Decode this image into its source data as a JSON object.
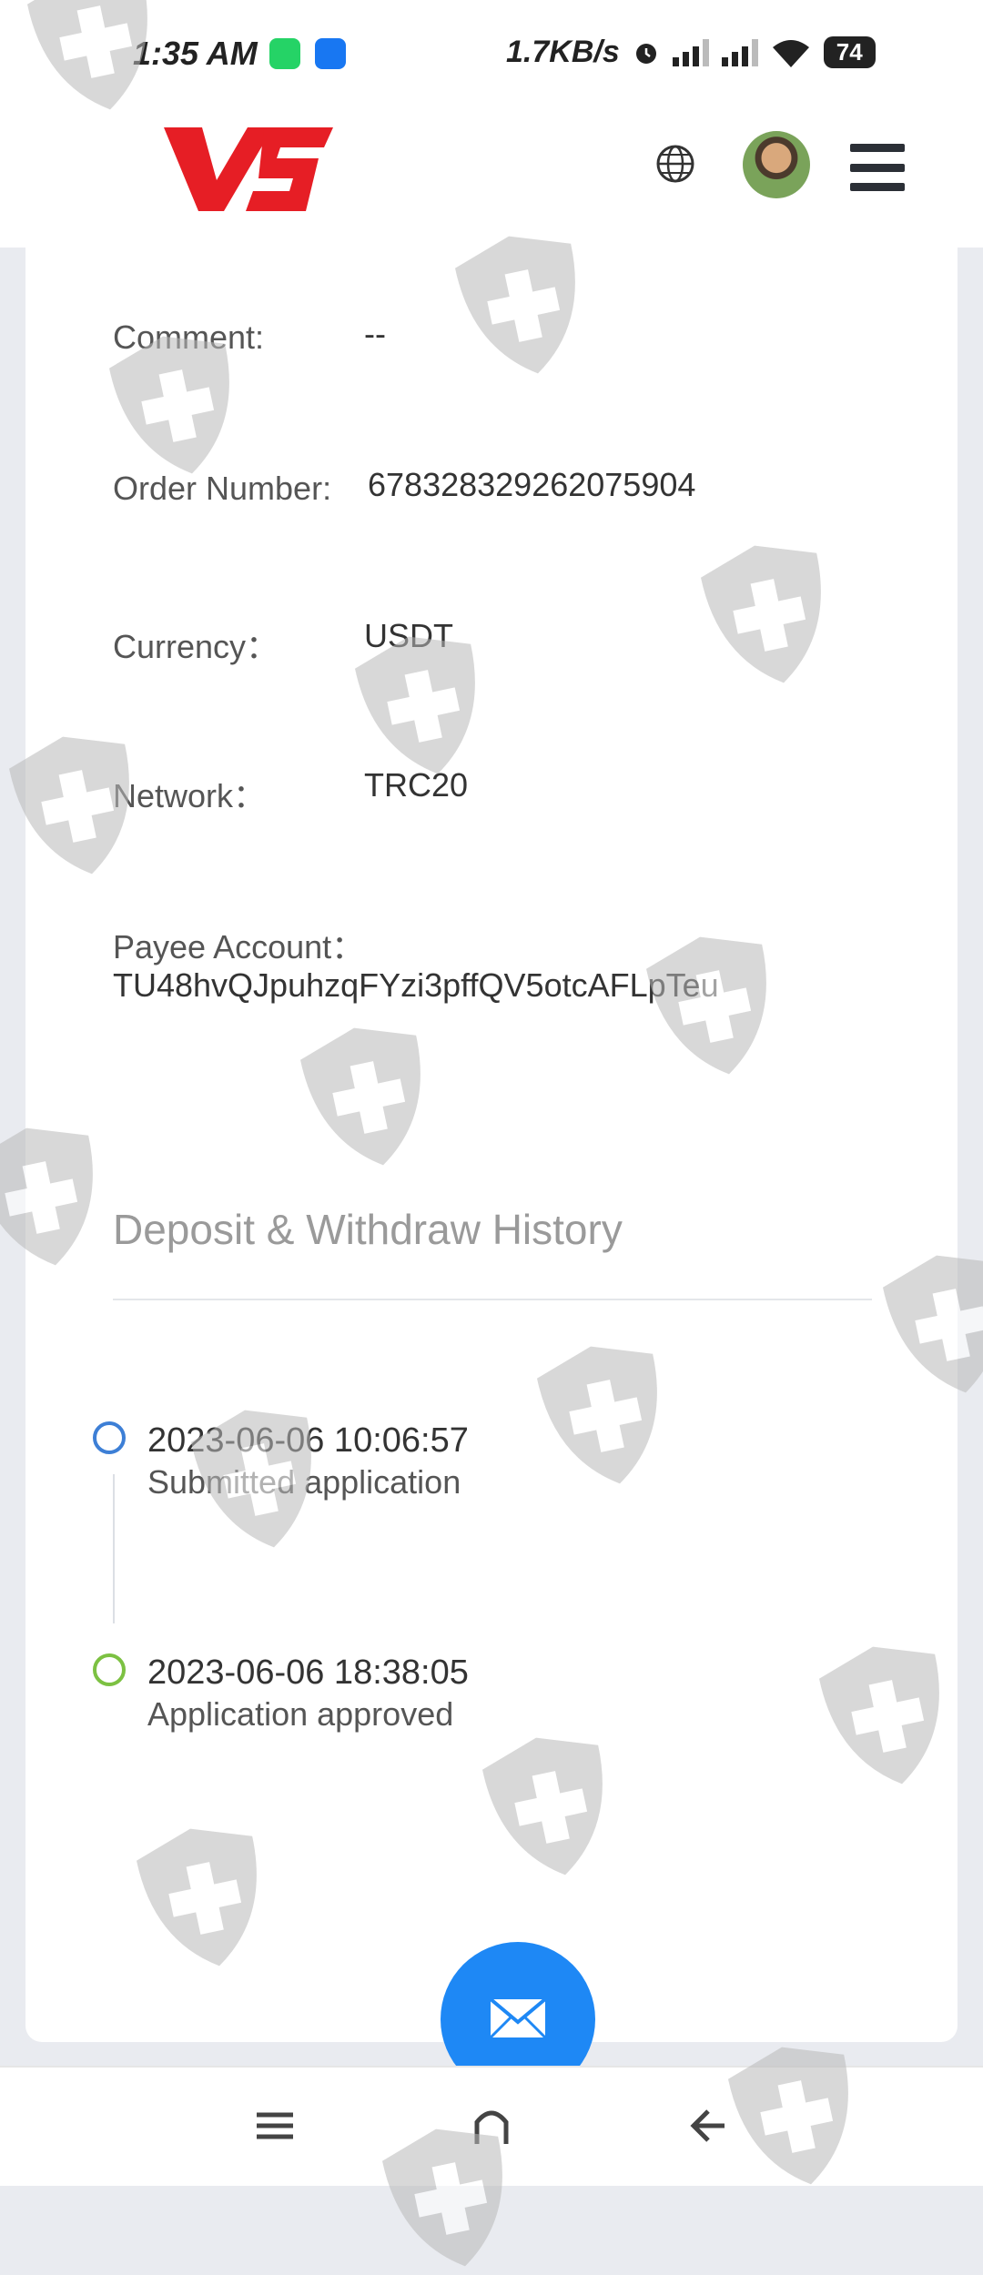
{
  "status_bar": {
    "time": "1:35 AM",
    "network_speed": "1.7KB/s",
    "battery": "74",
    "icons": [
      "whatsapp-icon",
      "facebook-icon",
      "alarm-icon",
      "signal-icon",
      "signal-icon",
      "wifi-icon",
      "battery-icon"
    ]
  },
  "header": {
    "logo_text": "VS",
    "brand_color": "#e61e25",
    "icons": [
      "globe-icon",
      "avatar",
      "hamburger-menu-icon"
    ]
  },
  "details": [
    {
      "label": "Comment:",
      "value": "--"
    },
    {
      "label": "Order Number:",
      "value": "678328329262075904"
    },
    {
      "label": "Currency：",
      "value": "USDT"
    },
    {
      "label": "Network：",
      "value": "TRC20"
    }
  ],
  "payee": {
    "label": "Payee Account：",
    "value": "TU48hvQJpuhzqFYzi3pffQV5otcAFLpTeu"
  },
  "history": {
    "title": "Deposit & Withdraw History",
    "items": [
      {
        "time": "2023-06-06 10:06:57",
        "text": "Submitted application",
        "color": "#3d7fd6"
      },
      {
        "time": "2023-06-06 18:38:05",
        "text": "Application approved",
        "color": "#7cc142"
      }
    ]
  },
  "fab": {
    "icon": "mail-icon",
    "color": "#1e88f5"
  },
  "nav": {
    "icons": [
      "menu-icon",
      "home-icon",
      "back-icon"
    ]
  }
}
